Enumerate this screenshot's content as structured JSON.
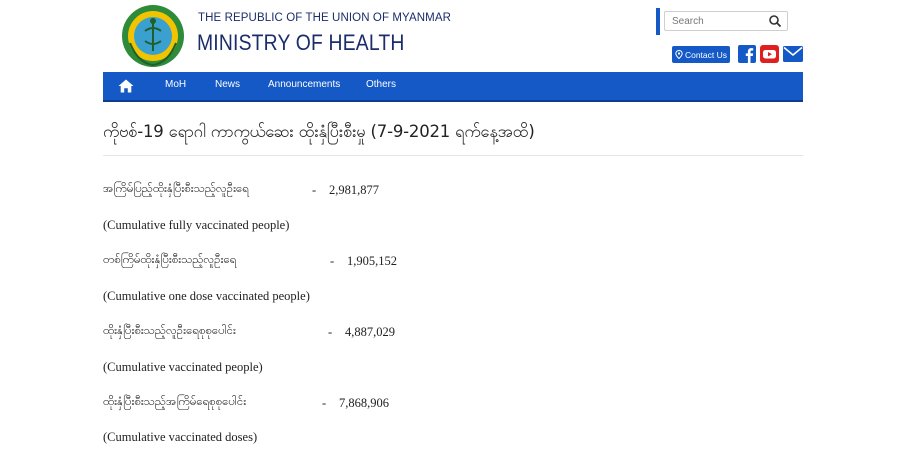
{
  "header": {
    "republic": "THE REPUBLIC OF THE UNION OF MYANMAR",
    "ministry": "MINISTRY OF HEALTH",
    "logo_text": "MINISTRY OF HEALTH",
    "search_placeholder": "Search",
    "contact_label": "Contact Us",
    "colors": {
      "brand": "#1559c6",
      "title": "#1b2d6b",
      "youtube": "#e02020",
      "logo_ring": "#2e8b3a",
      "logo_fill": "#f2c400"
    }
  },
  "nav": {
    "items": [
      "MoH",
      "News",
      "Announcements",
      "Others"
    ]
  },
  "page": {
    "title": "ကိုဗစ်-19 ရောဂါ ကာကွယ်ဆေး ထိုးနှံပြီးစီးမှု (7-9-2021 ရက်နေ့အထိ)"
  },
  "stats": [
    {
      "label": "အကြိမ်ပြည့်ထိုးနှံပြီးစီးသည့်လူဦးရေ",
      "dash": "-",
      "value": "2,981,877",
      "english": "(Cumulative fully vaccinated people)"
    },
    {
      "label": "တစ်ကြိမ်ထိုးနှံပြီးစီးသည့်လူဦးရေ",
      "dash": "-",
      "value": "1,905,152",
      "english": "(Cumulative one dose vaccinated people)"
    },
    {
      "label": "ထိုးနှံပြီးစီးသည့်လူဦးရေစုစုပေါင်း",
      "dash": "-",
      "value": "4,887,029",
      "english": "(Cumulative vaccinated people)"
    },
    {
      "label": "ထိုးနှံပြီးစီးသည့်အကြိမ်ရေစုစုပေါင်း",
      "dash": "-",
      "value": "7,868,906",
      "english": "(Cumulative vaccinated doses)"
    }
  ]
}
